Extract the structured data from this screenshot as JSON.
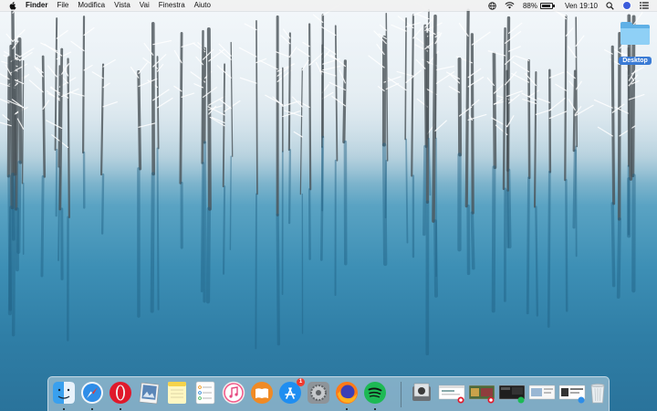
{
  "menubar": {
    "apple_icon": "apple-logo-icon",
    "app_name": "Finder",
    "menus": [
      "File",
      "Modifica",
      "Vista",
      "Vai",
      "Finestra",
      "Aiuto"
    ],
    "status": {
      "battery_percent_label": "88%",
      "battery_level": 0.88,
      "clock": "Ven 19:10"
    }
  },
  "desktop": {
    "folder_label": "Desktop",
    "folder_color": "#7cc4f0"
  },
  "dock": {
    "apps": [
      {
        "name": "finder-icon",
        "running": true
      },
      {
        "name": "safari-icon",
        "running": true
      },
      {
        "name": "opera-icon",
        "running": true
      },
      {
        "name": "preview-icon",
        "running": false
      },
      {
        "name": "notes-icon",
        "running": false
      },
      {
        "name": "reminders-icon",
        "running": false
      },
      {
        "name": "itunes-icon",
        "running": false
      },
      {
        "name": "ibooks-icon",
        "running": false
      },
      {
        "name": "app-store-icon",
        "running": false,
        "badge": "1"
      },
      {
        "name": "system-preferences-icon",
        "running": false
      },
      {
        "name": "firefox-icon",
        "running": true
      },
      {
        "name": "spotify-icon",
        "running": true
      }
    ],
    "minimized": [
      {
        "name": "downloads-stack-icon"
      },
      {
        "name": "minimized-window-opera-1"
      },
      {
        "name": "minimized-window-opera-2"
      },
      {
        "name": "minimized-window-spotify"
      },
      {
        "name": "minimized-window-preview"
      },
      {
        "name": "minimized-window-safari"
      },
      {
        "name": "trash-icon"
      }
    ]
  }
}
